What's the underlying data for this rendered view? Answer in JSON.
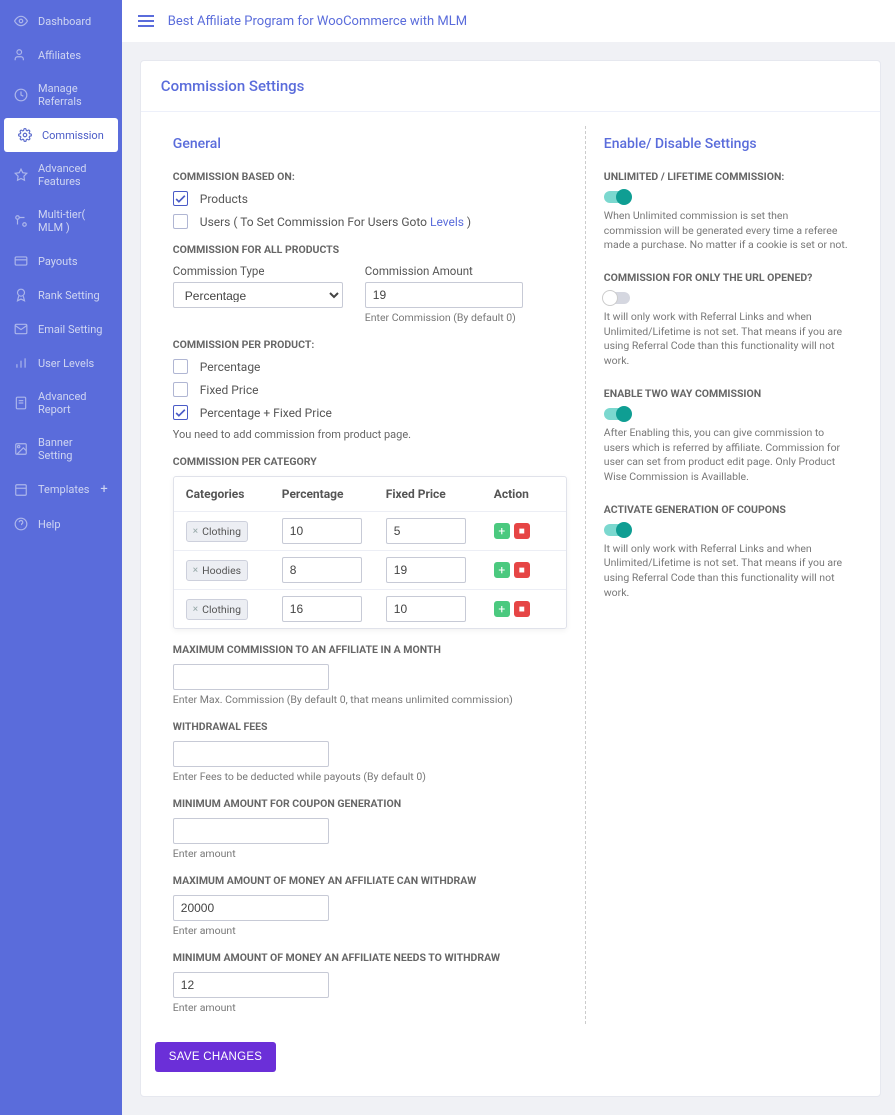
{
  "topbar": {
    "title": "Best Affiliate Program for WooCommerce with MLM"
  },
  "sidebar": {
    "items": [
      {
        "label": "Dashboard"
      },
      {
        "label": "Affiliates"
      },
      {
        "label": "Manage Referrals"
      },
      {
        "label": "Commission"
      },
      {
        "label": "Advanced Features"
      },
      {
        "label": "Multi-tier( MLM )"
      },
      {
        "label": "Payouts"
      },
      {
        "label": "Rank Setting"
      },
      {
        "label": "Email Setting"
      },
      {
        "label": "User Levels"
      },
      {
        "label": "Advanced Report"
      },
      {
        "label": "Banner Setting"
      },
      {
        "label": "Templates"
      },
      {
        "label": "Help"
      }
    ]
  },
  "page": {
    "title": "Commission Settings"
  },
  "general": {
    "heading": "General",
    "basedOnLabel": "COMMISSION BASED ON:",
    "basedOn": {
      "products_label": "Products",
      "users_prefix": "Users ( To Set Commission For Users Goto ",
      "users_link": "Levels",
      "users_suffix": " )"
    },
    "allProducts": {
      "label": "COMMISSION FOR ALL PRODUCTS",
      "type_label": "Commission Type",
      "type_value": "Percentage",
      "amount_label": "Commission Amount",
      "amount_value": "19",
      "amount_hint": "Enter Commission (By default 0)"
    },
    "perProduct": {
      "label": "COMMISSION PER PRODUCT:",
      "opt1": "Percentage",
      "opt2": "Fixed Price",
      "opt3": "Percentage + Fixed Price",
      "note": "You need to add commission from product page."
    },
    "perCategory": {
      "label": "COMMISSION PER CATEGORY",
      "h1": "Categories",
      "h2": "Percentage",
      "h3": "Fixed Price",
      "h4": "Action",
      "rows": [
        {
          "tag": "Clothing",
          "pct": "10",
          "fp": "5"
        },
        {
          "tag": "Hoodies",
          "pct": "8",
          "fp": "19"
        },
        {
          "tag": "Clothing",
          "pct": "16",
          "fp": "10"
        }
      ]
    },
    "maxMonth": {
      "label": "MAXIMUM COMMISSION TO AN AFFILIATE IN A MONTH",
      "value": "",
      "hint": "Enter Max. Commission (By default 0, that means unlimited commission)"
    },
    "withdrawFees": {
      "label": "WITHDRAWAL FEES",
      "value": "",
      "hint": "Enter Fees to be deducted while payouts (By default 0)"
    },
    "minCoupon": {
      "label": "MINIMUM AMOUNT FOR COUPON GENERATION",
      "value": "",
      "hint": "Enter amount"
    },
    "maxWithdraw": {
      "label": "MAXIMUM AMOUNT OF MONEY AN AFFILIATE CAN WITHDRAW",
      "value": "20000",
      "hint": "Enter amount"
    },
    "minWithdraw": {
      "label": "MINIMUM AMOUNT OF MONEY AN AFFILIATE NEEDS TO WITHDRAW",
      "value": "12",
      "hint": "Enter amount"
    }
  },
  "settings": {
    "heading": "Enable/ Disable Settings",
    "s1": {
      "label": "UNLIMITED / LIFETIME COMMISSION:",
      "on": true,
      "desc": "When Unlimited commission is set then commission will be generated every time a referee made a purchase. No matter if a cookie is set or not."
    },
    "s2": {
      "label": "COMMISSION FOR ONLY THE URL OPENED?",
      "on": false,
      "desc": "It will only work with Referral Links and when Unlimited/Lifetime is not set. That means if you are using Referral Code than this functionality will not work."
    },
    "s3": {
      "label": "ENABLE TWO WAY COMMISSION",
      "on": true,
      "desc": "After Enabling this, you can give commission to users which is referred by affiliate. Commission for user can set from product edit page. Only Product Wise Commission is Availlable."
    },
    "s4": {
      "label": "ACTIVATE GENERATION OF COUPONS",
      "on": true,
      "desc": "It will only work with Referral Links and when Unlimited/Lifetime is not set. That means if you are using Referral Code than this functionality will not work."
    }
  },
  "save_label": "SAVE CHANGES"
}
